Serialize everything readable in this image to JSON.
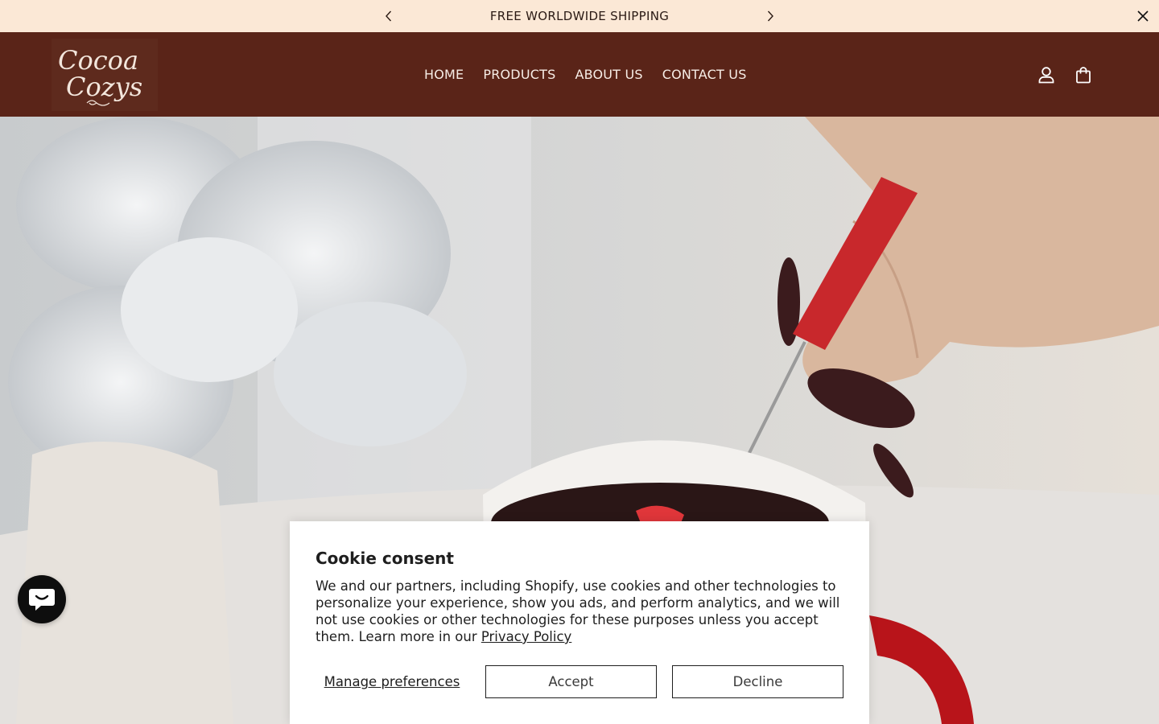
{
  "announcement": {
    "text": "FREE WORLDWIDE SHIPPING",
    "prev_icon": "chevron-left-icon",
    "next_icon": "chevron-right-icon",
    "close_icon": "close-icon"
  },
  "header": {
    "logo_line1": "Cocoa",
    "logo_line2": "Cozys",
    "nav": [
      "HOME",
      "PRODUCTS",
      "ABOUT US",
      "CONTACT US"
    ],
    "account_icon": "user-icon",
    "cart_icon": "shopping-bag-icon"
  },
  "colors": {
    "announcement_bg": "#fbe8d6",
    "header_bg": "#5a2418",
    "nav_text": "#f7ede6",
    "cookie_bg": "#ffffff"
  },
  "chat": {
    "icon": "chat-bubble-icon"
  },
  "cookie": {
    "title": "Cookie consent",
    "body": "We and our partners, including Shopify, use cookies and other technologies to personalize your experience, show you ads, and perform analytics, and we will not use cookies or other technologies for these purposes unless you accept them. Learn more in our ",
    "link_text": "Privacy Policy",
    "manage_label": "Manage preferences",
    "accept_label": "Accept",
    "decline_label": "Decline"
  }
}
